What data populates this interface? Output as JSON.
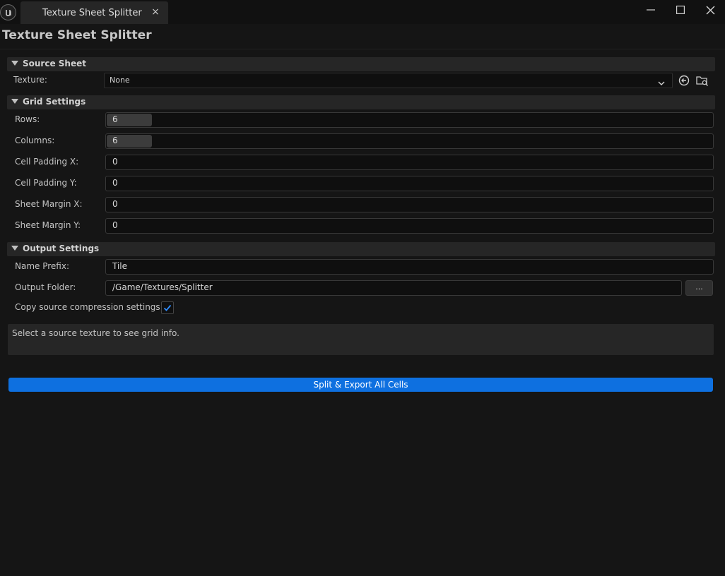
{
  "window": {
    "tab_title": "Texture Sheet Splitter",
    "tab_close": "×"
  },
  "panel": {
    "title": "Texture Sheet Splitter"
  },
  "source_sheet": {
    "header": "Source Sheet",
    "texture_label": "Texture:",
    "texture_value": "None"
  },
  "grid_settings": {
    "header": "Grid Settings",
    "fields": [
      {
        "label": "Rows:",
        "value": "6"
      },
      {
        "label": "Columns:",
        "value": "6"
      },
      {
        "label": "Cell Padding X:",
        "value": "0"
      },
      {
        "label": "Cell Padding Y:",
        "value": "0"
      },
      {
        "label": "Sheet Margin X:",
        "value": "0"
      },
      {
        "label": "Sheet Margin Y:",
        "value": "0"
      }
    ]
  },
  "output_settings": {
    "header": "Output Settings",
    "name_prefix_label": "Name Prefix:",
    "name_prefix_value": "Tile",
    "output_folder_label": "Output Folder:",
    "output_folder_value": "/Game/Textures/Splitter",
    "browse_label": "...",
    "copy_compression_label": "Copy source compression settings",
    "copy_compression_checked": true
  },
  "info": {
    "message": "Select a source texture to see grid info."
  },
  "actions": {
    "split_export_label": "Split & Export All Cells"
  },
  "colors": {
    "background": "#151515",
    "section_header": "#262626",
    "field_bg": "#0f0f0f",
    "accent": "#0e70e0",
    "checkmark": "#2f8cff"
  },
  "icons": {
    "logo": "unreal-logo-icon",
    "minimize": "minimize-icon",
    "maximize": "maximize-icon",
    "close": "close-icon",
    "use_selected": "use-selected-asset-icon",
    "browse_asset": "browse-asset-icon",
    "dropdown": "chevron-down-icon",
    "section_collapse": "triangle-down-icon",
    "check": "checkmark-icon"
  }
}
